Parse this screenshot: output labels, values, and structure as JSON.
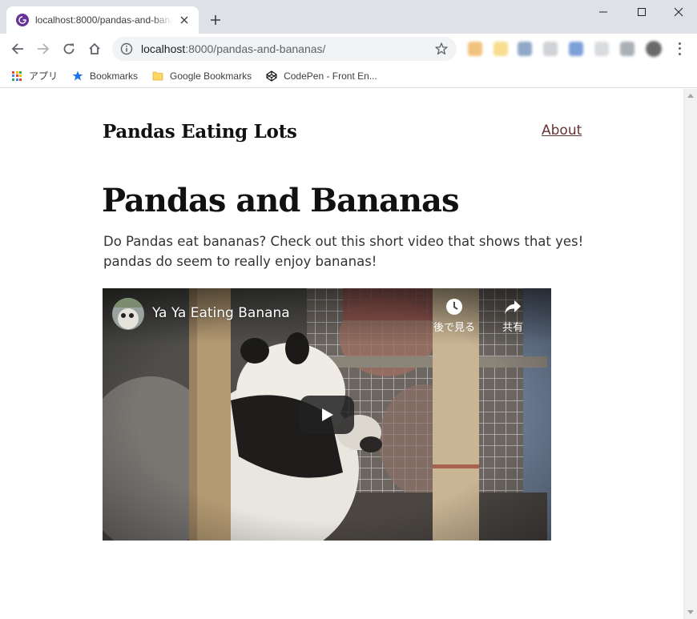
{
  "browser": {
    "tab": {
      "title": "localhost:8000/pandas-and-bananas/"
    },
    "url_host": "localhost",
    "url_rest": ":8000/pandas-and-bananas/",
    "bookmarks": [
      {
        "label": "アプリ",
        "icon": "apps-grid-icon"
      },
      {
        "label": "Bookmarks",
        "icon": "star-icon"
      },
      {
        "label": "Google Bookmarks",
        "icon": "folder-icon"
      },
      {
        "label": "CodePen - Front En...",
        "icon": "codepen-icon"
      }
    ]
  },
  "page": {
    "site_title": "Pandas Eating Lots",
    "nav": {
      "about_label": "About"
    },
    "heading": "Pandas and Bananas",
    "description": "Do Pandas eat bananas? Check out this short video that shows that yes! pandas do seem to really enjoy bananas!",
    "video": {
      "title": "Ya Ya Eating Banana",
      "watch_later_label": "後で見る",
      "share_label": "共有"
    }
  },
  "colors": {
    "tabstrip": "#dee1e6",
    "link": "#663333",
    "gatsby_purple": "#663399"
  }
}
